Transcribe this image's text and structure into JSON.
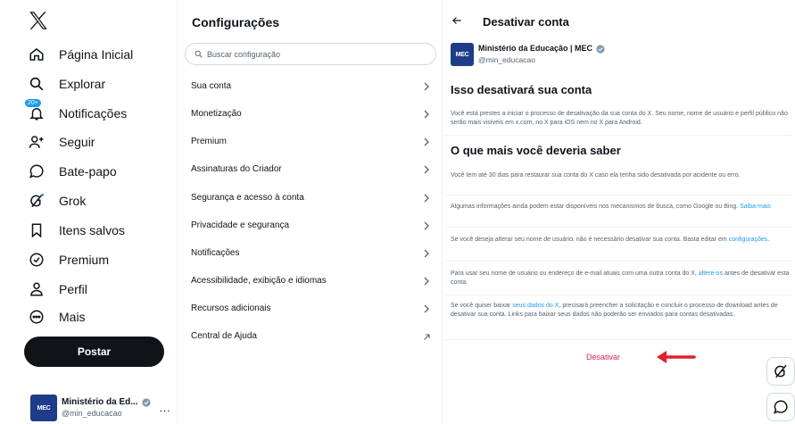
{
  "nav": {
    "items": [
      {
        "label": "Página Inicial",
        "icon": "home-icon"
      },
      {
        "label": "Explorar",
        "icon": "search-icon"
      },
      {
        "label": "Notificações",
        "icon": "bell-icon",
        "badge": "20+"
      },
      {
        "label": "Seguir",
        "icon": "follow-icon"
      },
      {
        "label": "Bate-papo",
        "icon": "chat-icon"
      },
      {
        "label": "Grok",
        "icon": "grok-icon"
      },
      {
        "label": "Itens salvos",
        "icon": "bookmark-icon"
      },
      {
        "label": "Premium",
        "icon": "premium-icon"
      },
      {
        "label": "Perfil",
        "icon": "person-icon"
      },
      {
        "label": "Mais",
        "icon": "more-icon"
      }
    ],
    "post_label": "Postar",
    "account": {
      "name": "Ministério da Ed...",
      "handle": "@min_educacao",
      "more": "...",
      "avatar_text": "MEC"
    }
  },
  "settings": {
    "title": "Configurações",
    "search_placeholder": "Buscar configuração",
    "items": [
      {
        "label": "Sua conta"
      },
      {
        "label": "Monetização"
      },
      {
        "label": "Premium"
      },
      {
        "label": "Assinaturas do Criador"
      },
      {
        "label": "Segurança e acesso à conta"
      },
      {
        "label": "Privacidade e segurança"
      },
      {
        "label": "Notificações"
      },
      {
        "label": "Acessibilidade, exibição e idiomas"
      },
      {
        "label": "Recursos adicionais"
      },
      {
        "label": "Central de Ajuda"
      }
    ]
  },
  "deactivate": {
    "title": "Desativar conta",
    "profile": {
      "name": "Ministério da Educação | MEC",
      "handle": "@min_educacao",
      "avatar_text": "MEC"
    },
    "heading1": "Isso desativará sua conta",
    "para1": "Você está prestes a iniciar o processo de desativação da sua conta do X. Seu nome, nome de usuário e perfil público não serão mais visíveis em x.com, no X para iOS nem no X para Android.",
    "heading2": "O que mais você deveria saber",
    "para2": "Você tem até 30 dias para restaurar sua conta do X caso ela tenha sido desativada por acidente ou erro.",
    "para3_text": "Algumas informações ainda podem estar disponíveis nos mecanismos de busca, como Google ou Bing.",
    "para3_link": "Saiba mais",
    "para4_text": "Se você deseja alterar seu nome de usuário, não é necessário desativar sua conta. Basta editar em",
    "para4_link": "configurações",
    "para4_end": ".",
    "para5_text": "Para usar seu nome de usuário ou endereço de e-mail atuais com uma outra conta do X,",
    "para5_link": "altere-os",
    "para5_end": "antes de desativar esta conta.",
    "para6_text": "Se você quiser baixar",
    "para6_link": "seus dados do X",
    "para6_end": ", precisará preencher a solicitação e concluir o processo de download antes de desativar sua conta. Links para baixar seus dados não poderão ser enviados para contas desativadas.",
    "deactivate_label": "Desativar"
  },
  "colors": {
    "accent": "#1d9bf0",
    "danger": "#e0245e",
    "arrow": "#e0202a",
    "brand_avatar": "#1d3c8a"
  }
}
